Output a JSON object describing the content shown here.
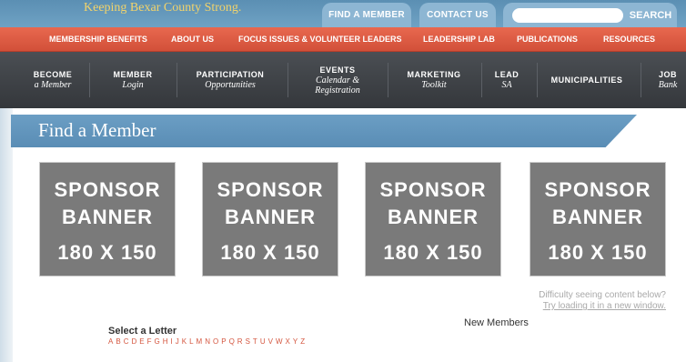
{
  "header": {
    "tagline": "Keeping Bexar County Strong.",
    "find_member": "FIND A MEMBER",
    "contact_us": "CONTACT US",
    "search_placeholder": "",
    "search_label": "SEARCH"
  },
  "menu": {
    "items": [
      "MEMBERSHIP BENEFITS",
      "ABOUT US",
      "FOCUS ISSUES & VOLUNTEER LEADERS",
      "LEADERSHIP LAB",
      "PUBLICATIONS",
      "RESOURCES"
    ]
  },
  "subnav": {
    "items": [
      {
        "main": "BECOME",
        "sub": "a Member"
      },
      {
        "main": "MEMBER",
        "sub": "Login"
      },
      {
        "main": "PARTICIPATION",
        "sub": "Opportunities"
      },
      {
        "main": "EVENTS",
        "sub": "Calendar &",
        "sub2": "Registration"
      },
      {
        "main": "MARKETING",
        "sub": "Toolkit"
      },
      {
        "main": "LEAD",
        "sub": "SA"
      },
      {
        "main": "MUNICIPALITIES",
        "sub": ""
      },
      {
        "main": "JOB",
        "sub": "Bank"
      }
    ]
  },
  "page": {
    "title": "Find a Member"
  },
  "sponsors": [
    {
      "line1": "SPONSOR",
      "line2": "BANNER",
      "line3": "180 X 150"
    },
    {
      "line1": "SPONSOR",
      "line2": "BANNER",
      "line3": "180 X 150"
    },
    {
      "line1": "SPONSOR",
      "line2": "BANNER",
      "line3": "180 X 150"
    },
    {
      "line1": "SPONSOR",
      "line2": "BANNER",
      "line3": "180 X 150"
    }
  ],
  "hint": {
    "line1": "Difficulty seeing content below?",
    "link": "Try loading it in a new window."
  },
  "directory": {
    "select_label": "Select a Letter",
    "letters": [
      "A",
      "B",
      "C",
      "D",
      "E",
      "F",
      "G",
      "H",
      "I",
      "J",
      "K",
      "L",
      "M",
      "N",
      "O",
      "P",
      "Q",
      "R",
      "S",
      "T",
      "U",
      "V",
      "W",
      "X",
      "Y",
      "Z"
    ],
    "new_members": "New Members"
  },
  "colors": {
    "accent_red": "#d25039",
    "header_blue": "#6fa2c4",
    "nav_dark": "#3c3f43",
    "tagline_gold": "#f2d36b"
  }
}
